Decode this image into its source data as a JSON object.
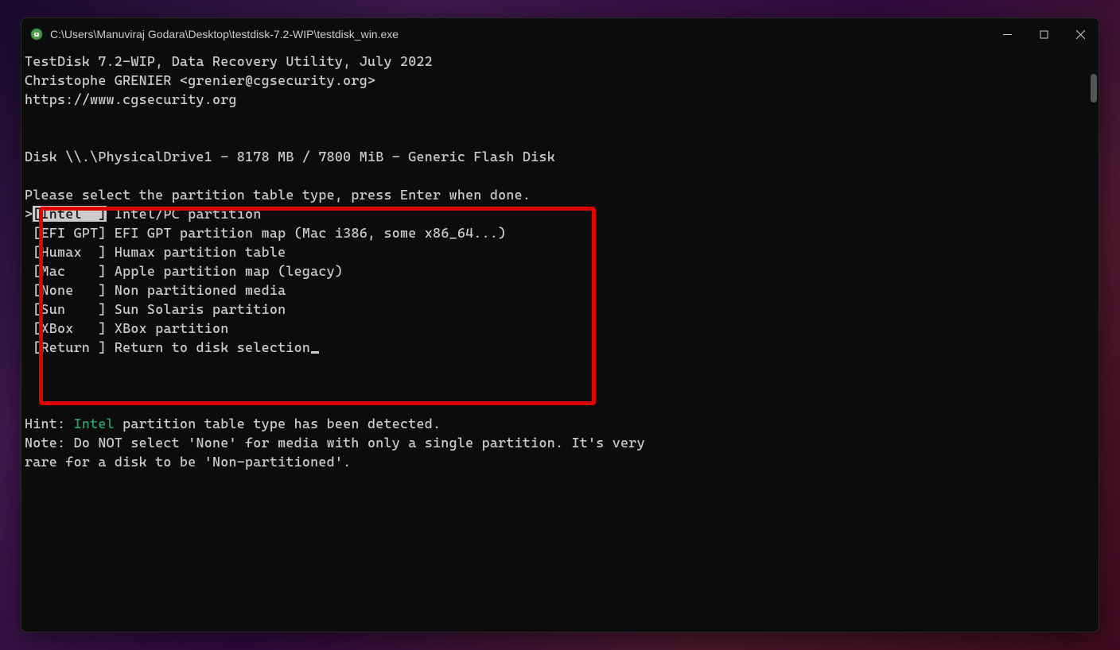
{
  "titlebar": {
    "title": "C:\\Users\\Manuviraj Godara\\Desktop\\testdisk-7.2-WIP\\testdisk_win.exe"
  },
  "header": {
    "line1": "TestDisk 7.2-WIP, Data Recovery Utility, July 2022",
    "line2": "Christophe GRENIER <grenier@cgsecurity.org>",
    "line3": "https://www.cgsecurity.org"
  },
  "disk_info": "Disk \\\\.\\PhysicalDrive1 - 8178 MB / 7800 MiB - Generic Flash Disk",
  "prompt": "Please select the partition table type, press Enter when done.",
  "menu": {
    "selected_index": 0,
    "selector": ">",
    "items": [
      {
        "label": "Intel  ",
        "desc": "Intel/PC partition"
      },
      {
        "label": "EFI GPT",
        "desc": "EFI GPT partition map (Mac i386, some x86_64...)"
      },
      {
        "label": "Humax  ",
        "desc": "Humax partition table"
      },
      {
        "label": "Mac    ",
        "desc": "Apple partition map (legacy)"
      },
      {
        "label": "None   ",
        "desc": "Non partitioned media"
      },
      {
        "label": "Sun    ",
        "desc": "Sun Solaris partition"
      },
      {
        "label": "XBox   ",
        "desc": "XBox partition"
      },
      {
        "label": "Return ",
        "desc": "Return to disk selection"
      }
    ]
  },
  "hint": {
    "prefix": "Hint: ",
    "detected": "Intel",
    "suffix": " partition table type has been detected."
  },
  "note": {
    "line1": "Note: Do NOT select 'None' for media with only a single partition. It's very",
    "line2": "rare for a disk to be 'Non-partitioned'."
  }
}
